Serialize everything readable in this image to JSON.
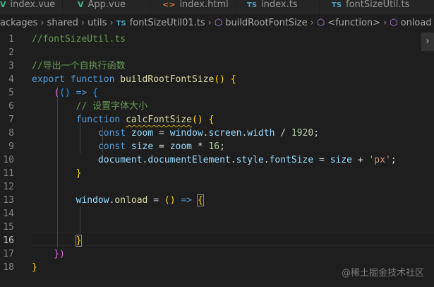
{
  "tabs": [
    {
      "icon": "V",
      "icon_kind": "vue",
      "label": "index.vue"
    },
    {
      "icon": "V",
      "icon_kind": "vue",
      "label": "App.vue"
    },
    {
      "icon": "<>",
      "icon_kind": "html",
      "label": "index.html"
    },
    {
      "icon": "TS",
      "icon_kind": "ts",
      "label": "index.ts"
    },
    {
      "icon": "TS",
      "icon_kind": "ts",
      "label": "fontSizeUtil.ts"
    }
  ],
  "breadcrumb": {
    "seg1": "ackages",
    "seg2": "shared",
    "seg3": "utils",
    "file_icon": "TS",
    "file": "fontSizeUtil01.ts",
    "sym1": "buildRootFontSize",
    "sym2": "<function>",
    "sym3": "onload"
  },
  "editor": {
    "line_numbers": [
      "1",
      "2",
      "3",
      "4",
      "5",
      "6",
      "7",
      "8",
      "9",
      "10",
      "11",
      "12",
      "13",
      "14",
      "15",
      "16",
      "17",
      "18"
    ],
    "active_line": "16",
    "tokens": {
      "l1_comment": "//fontSizeUtil.ts",
      "l3_comment": "//导出一个自执行函数",
      "l4_export": "export",
      "l4_function": "function",
      "l4_name": "buildRootFontSize",
      "l4_parens": "()",
      "l4_brace": "{",
      "l5_paren": "(",
      "l5_parens": "()",
      "l5_arrow": "=>",
      "l5_brace": "{",
      "l6_comment": "// 设置字体大小",
      "l7_function": "function",
      "l7_name": "calcFontSize",
      "l7_parens": "()",
      "l7_brace": "{",
      "l8_const": "const",
      "l8_var": "zoom",
      "l8_eq": "=",
      "l8_window": "window",
      "l8_screen": "screen",
      "l8_width": "width",
      "l8_div": "/",
      "l8_num": "1920",
      "l8_semi": ";",
      "l9_const": "const",
      "l9_var": "size",
      "l9_eq": "=",
      "l9_zoom": "zoom",
      "l9_mul": "*",
      "l9_num": "16",
      "l9_semi": ";",
      "l10_document": "document",
      "l10_docel": "documentElement",
      "l10_style": "style",
      "l10_fontsize": "fontSize",
      "l10_eq": "=",
      "l10_size": "size",
      "l10_plus": "+",
      "l10_str": "'px'",
      "l10_semi": ";",
      "l11_brace": "}",
      "l13_window": "window",
      "l13_onload": "onload",
      "l13_eq": "=",
      "l13_parens": "()",
      "l13_arrow": "=>",
      "l13_brace": "{",
      "l16_brace": "}",
      "l17_close": "})",
      "l18_brace": "}"
    }
  },
  "scroll_button": "›",
  "watermark": "@稀土掘金技术社区",
  "colors": {
    "background": "#1e1e1e",
    "comment": "#6a9955",
    "keyword": "#569cd6",
    "function": "#dcdcaa",
    "variable": "#9cdcfe",
    "number": "#b5cea8",
    "string": "#ce9178",
    "bracket1": "#ffd700",
    "bracket2": "#da70d6",
    "bracket3": "#179fff"
  }
}
